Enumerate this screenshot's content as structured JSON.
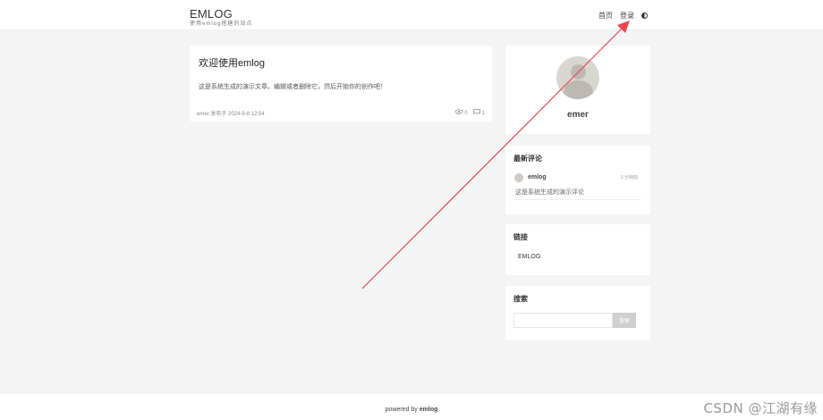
{
  "header": {
    "brand_title": "EMLOG",
    "brand_subtitle": "使用emlog搭建的站点",
    "nav": [
      {
        "label": "首页"
      },
      {
        "label": "登录"
      }
    ],
    "theme_icon": "half-circle-theme-icon"
  },
  "post": {
    "title": "欢迎使用emlog",
    "excerpt": "这是系统生成的演示文章。编辑或者删除它，然后开始你的创作吧！",
    "meta": "emer 发布于 2024-9-8 12:54",
    "views": "0",
    "comments": "1"
  },
  "profile": {
    "name": "emer"
  },
  "recent_comments": {
    "title": "最新评论",
    "items": [
      {
        "user": "emlog",
        "time": "3 分钟前",
        "text": "这是系统生成的演示评论"
      }
    ]
  },
  "links": {
    "title": "链接",
    "items": [
      {
        "label": "EMLOG"
      }
    ]
  },
  "search": {
    "title": "搜索",
    "placeholder": "",
    "button_label": "搜索"
  },
  "footer": {
    "prefix": "powered by",
    "brand": "emlog"
  },
  "watermark": "CSDN @江湖有缘",
  "colors": {
    "annotation_arrow": "#e8464f",
    "page_background": "#f4f4f4"
  }
}
